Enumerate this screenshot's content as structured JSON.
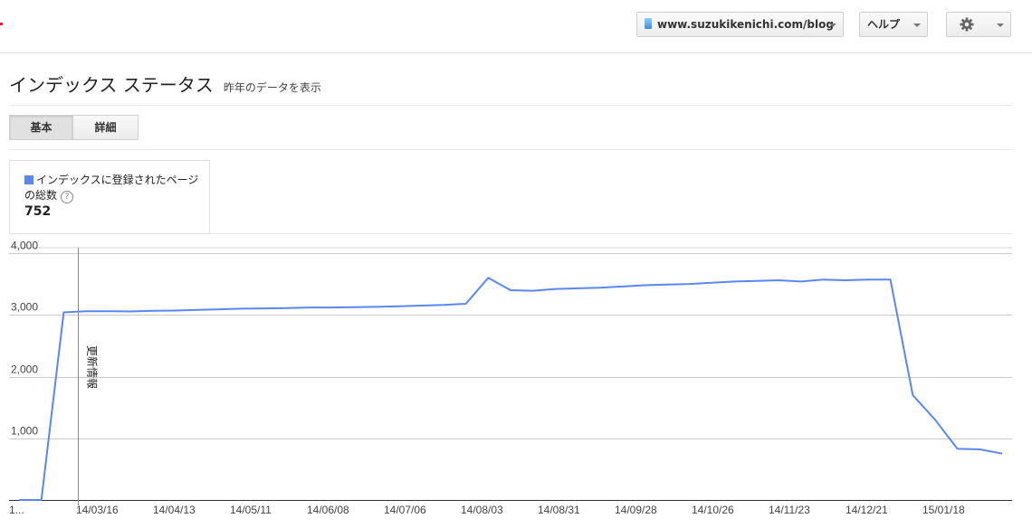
{
  "topbar": {
    "site_label": "www.suzukikenichi.com/blog",
    "help_label": "ヘルプ",
    "settings_icon": "gear-icon"
  },
  "page": {
    "title": "インデックス ステータス",
    "subtitle": "昨年のデータを表示"
  },
  "tabs": [
    {
      "label": "基本",
      "active": true
    },
    {
      "label": "詳細",
      "active": false
    }
  ],
  "legend": {
    "label": "インデックスに登録されたページの総数",
    "value": "752",
    "color": "#5b87f2"
  },
  "chart_data": {
    "type": "line",
    "series": [
      {
        "values": [
          0,
          0,
          3040,
          3060,
          3060,
          3055,
          3065,
          3070,
          3080,
          3090,
          3100,
          3105,
          3110,
          3120,
          3120,
          3125,
          3130,
          3140,
          3150,
          3160,
          3180,
          3600,
          3400,
          3390,
          3420,
          3430,
          3440,
          3460,
          3480,
          3490,
          3500,
          3520,
          3540,
          3550,
          3560,
          3540,
          3570,
          3560,
          3570,
          3570,
          1700,
          1300,
          830,
          820,
          752
        ]
      }
    ],
    "x_tick_labels": [
      "1...",
      "14/03/16",
      "14/04/13",
      "14/05/11",
      "14/06/08",
      "14/07/06",
      "14/08/03",
      "14/08/31",
      "14/09/28",
      "14/10/26",
      "14/11/23",
      "14/12/21",
      "15/01/18"
    ],
    "y_tick_labels": [
      "1,000",
      "2,000",
      "3,000",
      "4,000"
    ],
    "y_ticks": [
      1000,
      2000,
      3000,
      4000
    ],
    "ylim": [
      0,
      4000
    ],
    "annotation": "更新情報",
    "line_color": "#5b87f2",
    "grid": true
  }
}
